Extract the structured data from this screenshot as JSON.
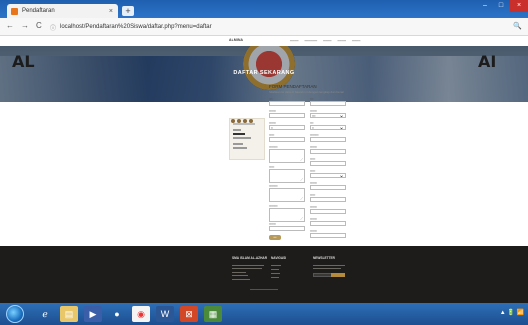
{
  "browser": {
    "tab_title": "Pendaftaran",
    "tab_close": "×",
    "new_tab": "+",
    "nav_back": "←",
    "nav_forward": "→",
    "nav_reload": "C",
    "url_info": "ⓘ",
    "url": "localhost/Pendaftaran%20Siswa/daftar.php?menu=daftar",
    "zoom_icon": "🔍"
  },
  "site": {
    "logo": "ᴬᴸᴹᴵᴺᴬ",
    "hero_title": "DAFTAR SEKARANG",
    "hero_left": "AL",
    "hero_right": "AI"
  },
  "form": {
    "title": "FORM PENDAFTARAN",
    "subtitle": "Silahkan isi data di bawah ini dengan lengkap dan benar"
  },
  "footer": {
    "col1_title": "SMA ISLAM AL-AZHAR",
    "col2_title": "NAVIGASI",
    "col3_title": "NEWSLETTER"
  },
  "taskbar": {
    "tray": "▲ 🔋 📶"
  },
  "colors": {
    "accent": "#b79a5a",
    "footer_bg": "#1e1c1a",
    "taskbar": "#2d6fb8"
  }
}
